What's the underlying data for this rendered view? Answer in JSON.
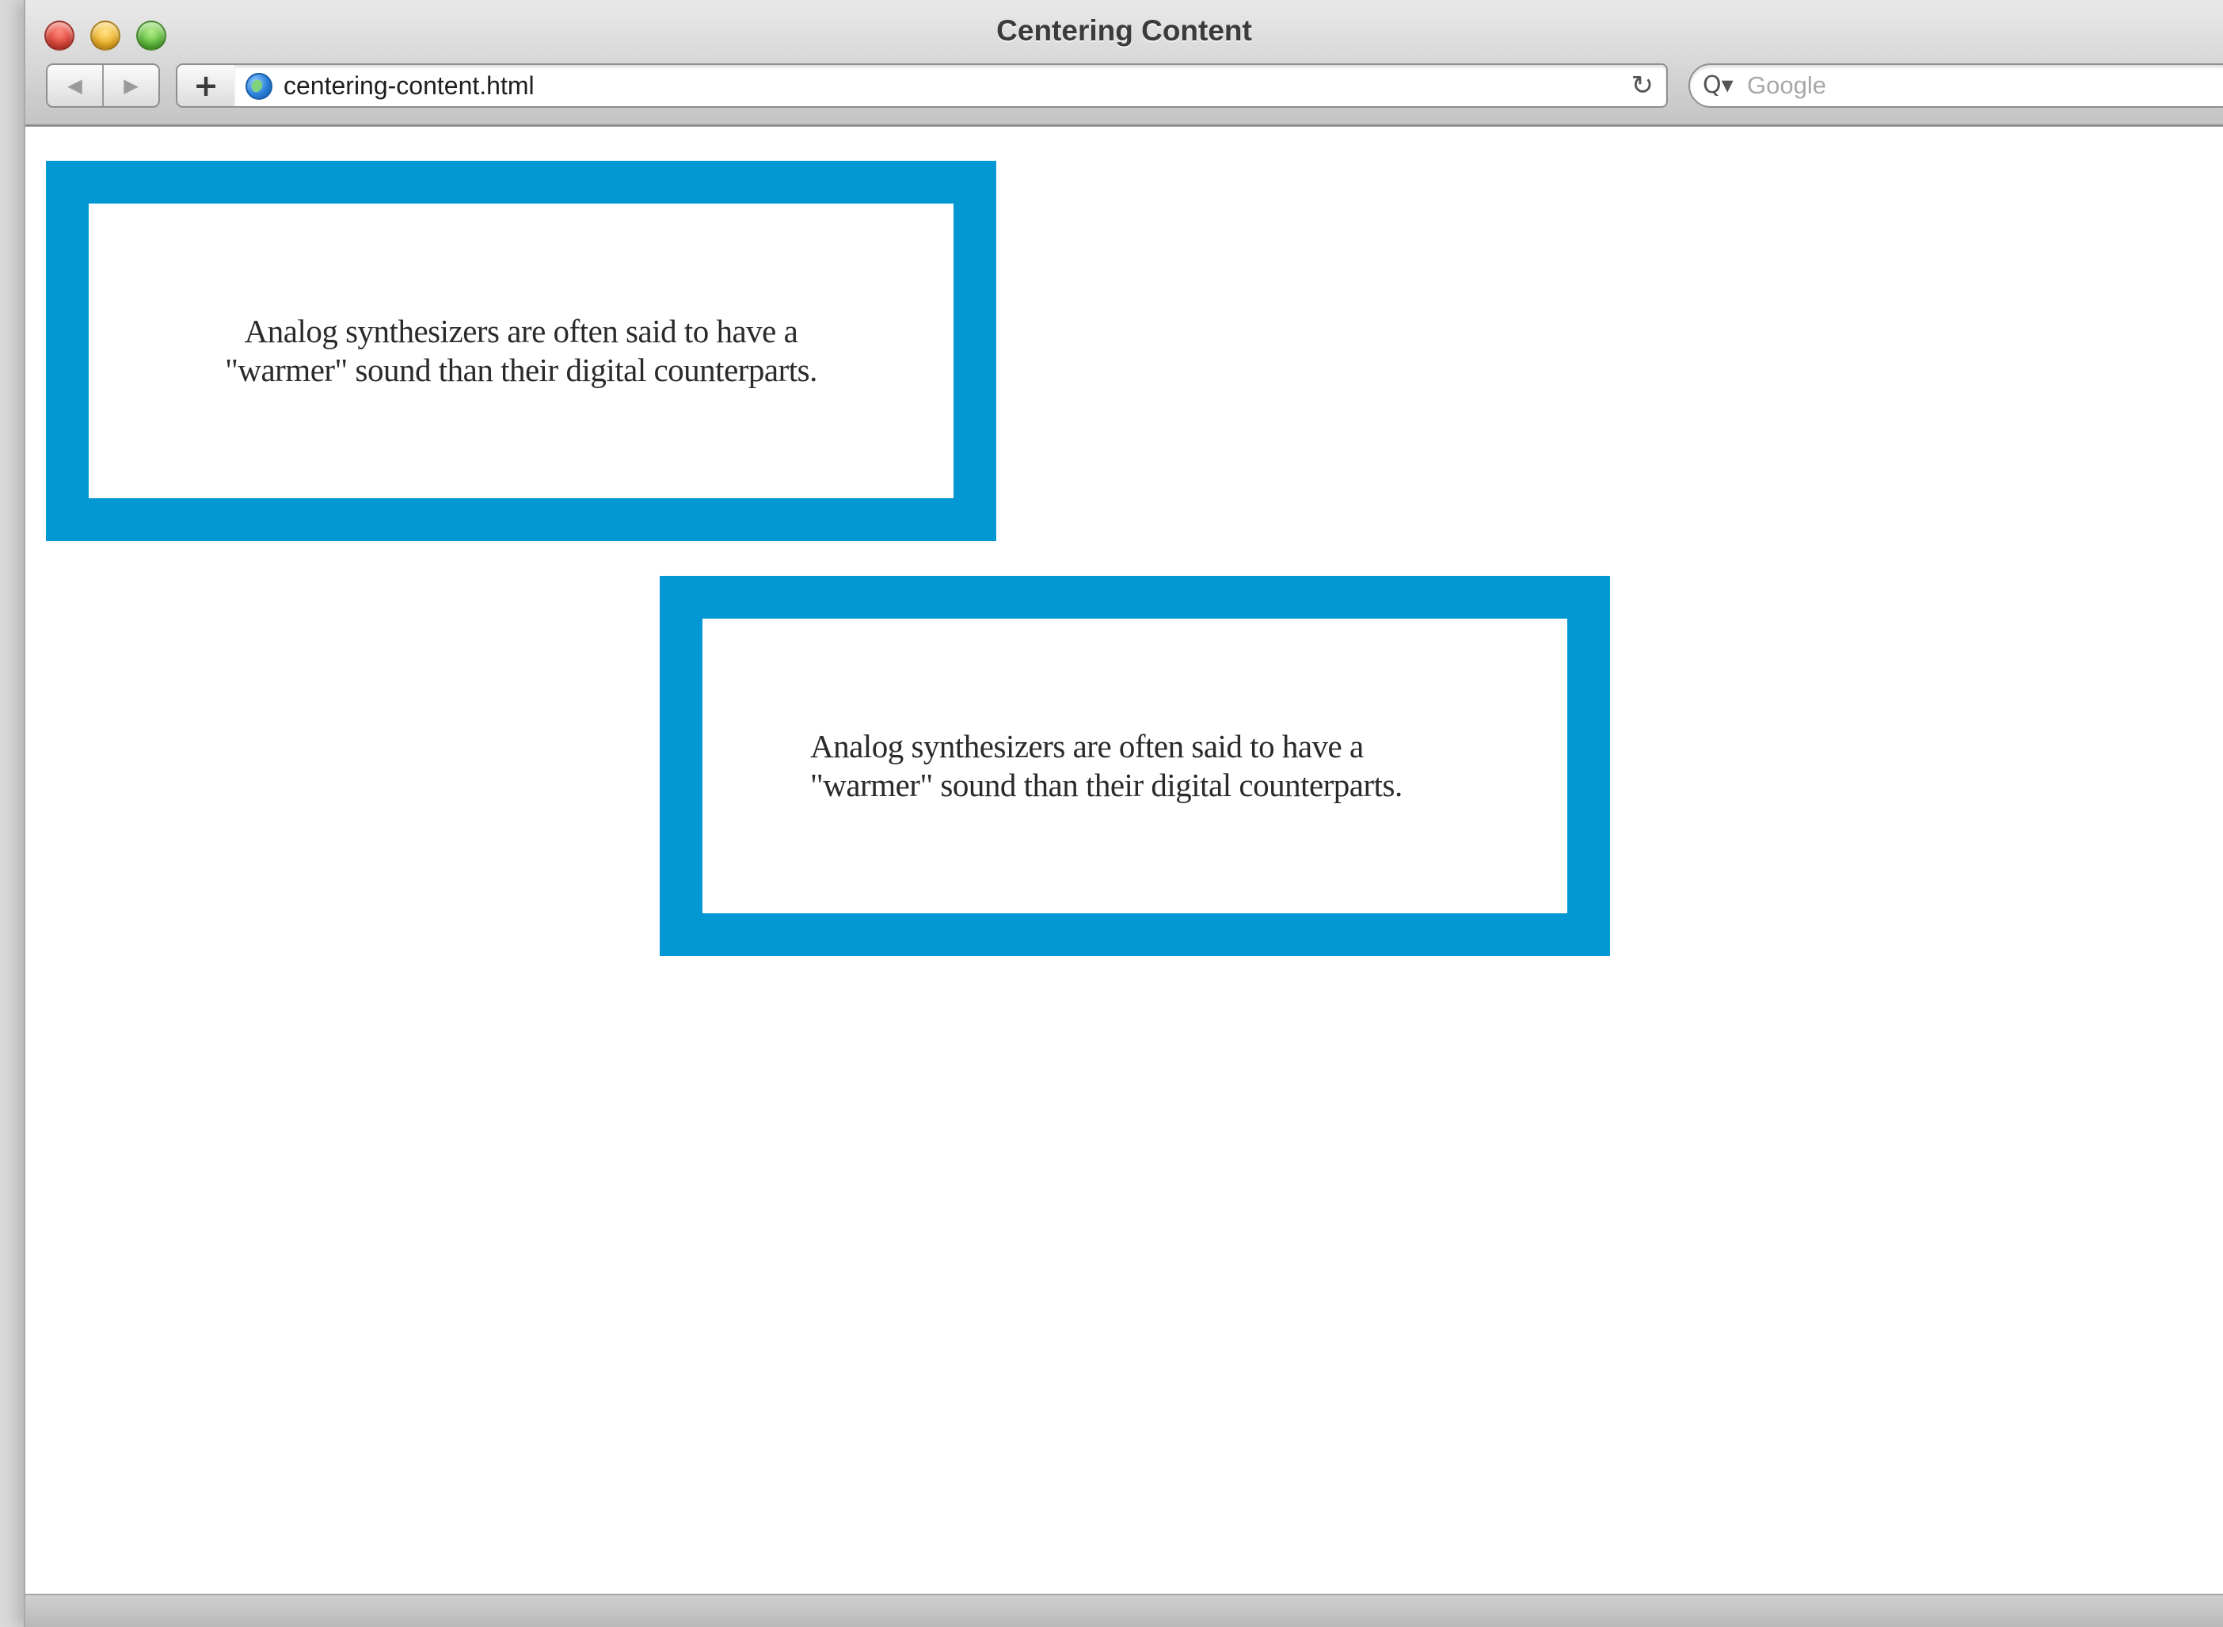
{
  "window": {
    "title": "Centering Content"
  },
  "toolbar": {
    "back_glyph": "◀",
    "forward_glyph": "▶",
    "add_glyph": "+",
    "url": "centering-content.html",
    "reload_glyph": "↻",
    "search_icon_glyph": "Q▾",
    "search_placeholder": "Google"
  },
  "content": {
    "boxes": [
      {
        "line1": "Analog synthesizers are often said to have a",
        "line2": "\"warmer\" sound than their digital counterparts."
      },
      {
        "line1": "Analog synthesizers are often said to have a",
        "line2": "\"warmer\" sound than their digital counterparts."
      }
    ],
    "border_color": "#0398d4"
  }
}
